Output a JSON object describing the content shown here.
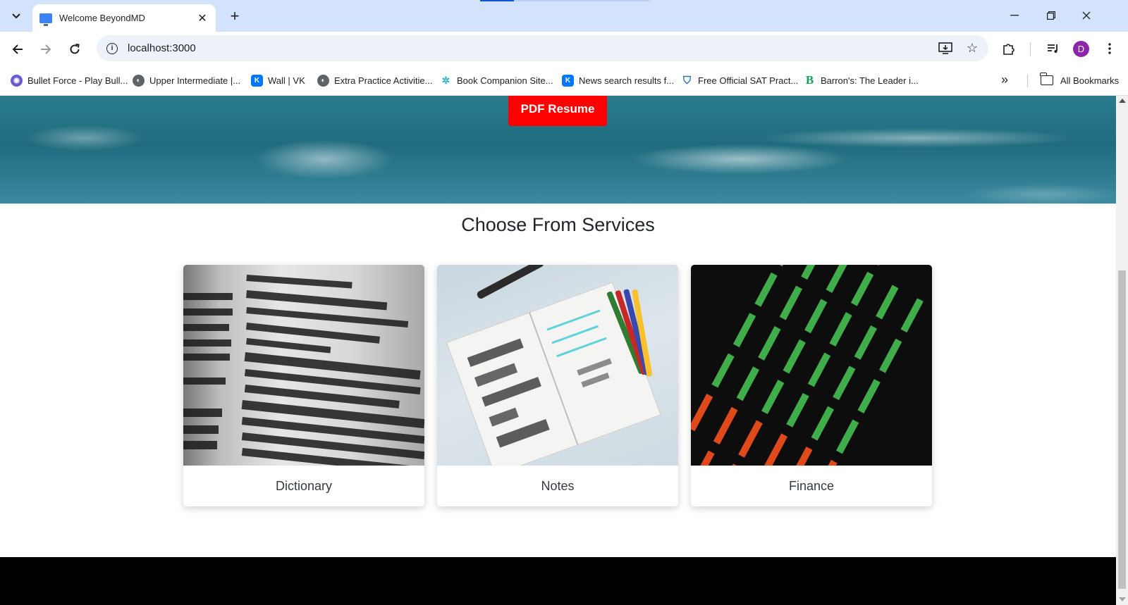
{
  "browser": {
    "tab_title": "Welcome BeyondMD",
    "url": "localhost:3000",
    "avatar_letter": "D",
    "bookmarks": [
      {
        "label": "Bullet Force - Play Bull...",
        "color": "#6b5bd6",
        "icon": "bulletforce-icon"
      },
      {
        "label": "Upper Intermediate |...",
        "color": "#5f6368",
        "icon": "globe-icon"
      },
      {
        "label": "Wall | VK",
        "color": "#0077ff",
        "icon": "vk-icon"
      },
      {
        "label": "Extra Practice Activitie...",
        "color": "#5f6368",
        "icon": "globe-icon"
      },
      {
        "label": "Book Companion Site...",
        "color": "#2bb3c0",
        "icon": "sparkle-icon"
      },
      {
        "label": "News search results f...",
        "color": "#0077ff",
        "icon": "vk-icon"
      },
      {
        "label": "Free Official SAT Pract...",
        "color": "#2f6fb6",
        "icon": "shield-icon"
      },
      {
        "label": "Barron's: The Leader i...",
        "color": "#12a05c",
        "icon": "barrons-icon"
      }
    ],
    "all_bookmarks_label": "All Bookmarks"
  },
  "page": {
    "pdf_button_label": "PDF Resume",
    "services_title": "Choose From Services",
    "services": [
      {
        "label": "Dictionary",
        "image": "dictionary-page-photo"
      },
      {
        "label": "Notes",
        "image": "notebook-markers-photo"
      },
      {
        "label": "Finance",
        "image": "stock-ticker-board-photo"
      }
    ],
    "colors": {
      "pdf_button": "#fe0000",
      "footer": "#000000"
    }
  }
}
